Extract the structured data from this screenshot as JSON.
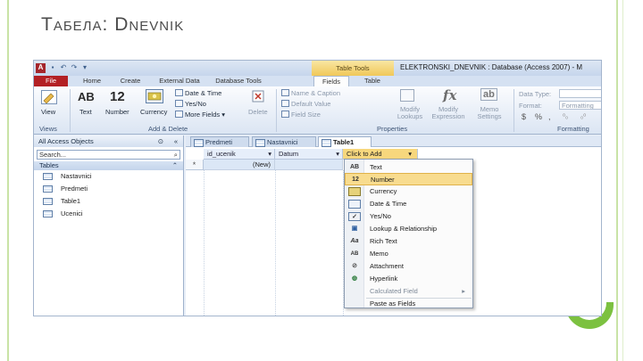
{
  "slide": {
    "title": "Табела: Dnevnik"
  },
  "window": {
    "context_tab_group": "Table Tools",
    "title": "ELEKTRONSKI_DNEVNIK : Database (Access 2007) - M"
  },
  "ribbon_tabs": [
    "File",
    "Home",
    "Create",
    "External Data",
    "Database Tools",
    "Fields",
    "Table"
  ],
  "ribbon": {
    "views": {
      "view": "View",
      "group": "Views"
    },
    "add_delete": {
      "text": "Text",
      "number": "Number",
      "currency": "Currency",
      "date_time": "Date & Time",
      "yes_no": "Yes/No",
      "more_fields": "More Fields",
      "delete": "Delete",
      "group": "Add & Delete",
      "glyph_ab": "AB",
      "glyph_12": "12"
    },
    "properties": {
      "name_caption": "Name & Caption",
      "default_value": "Default Value",
      "field_size": "Field Size",
      "modify_lookups": "Modify Lookups",
      "modify_expression": "Modify Expression",
      "memo_settings": "Memo Settings",
      "group": "Properties",
      "glyph_fx": "fx",
      "glyph_ab": "ab"
    },
    "formatting": {
      "data_type": "Data Type:",
      "format": "Format:",
      "format_value": "Formatting",
      "currency_sym": "$",
      "percent_sym": "%",
      "comma_sym": ",",
      "group": "Formatting"
    }
  },
  "nav": {
    "header": "All Access Objects",
    "search_placeholder": "Search...",
    "group": "Tables",
    "items": [
      "Nastavnici",
      "Predmeti",
      "Table1",
      "Ucenici"
    ]
  },
  "doc_tabs": [
    "Predmeti",
    "Nastavnici",
    "Table1"
  ],
  "grid": {
    "columns": [
      "id_ucenik",
      "Datum",
      "Click to Add"
    ],
    "new_row_marker": "*",
    "new_row_value": "(New)"
  },
  "dropdown_menu": {
    "items": [
      {
        "icon": "AB",
        "label": "Text"
      },
      {
        "icon": "12",
        "label": "Number"
      },
      {
        "icon": "$",
        "label": "Currency"
      },
      {
        "icon": "date",
        "label": "Date & Time"
      },
      {
        "icon": "check",
        "label": "Yes/No"
      },
      {
        "icon": "lookup",
        "label": "Lookup & Relationship"
      },
      {
        "icon": "Aa",
        "label": "Rich Text"
      },
      {
        "icon": "AB",
        "label": "Memo"
      },
      {
        "icon": "clip",
        "label": "Attachment"
      },
      {
        "icon": "globe",
        "label": "Hyperlink"
      },
      {
        "icon": "",
        "label": "Calculated Field"
      },
      {
        "icon": "",
        "label": "Paste as Fields"
      }
    ],
    "highlighted_index": 1
  },
  "colors": {
    "accent_green": "#7cc140",
    "file_tab": "#b32024",
    "context_tab": "#f0c859",
    "highlight": "#f8dc8f"
  }
}
